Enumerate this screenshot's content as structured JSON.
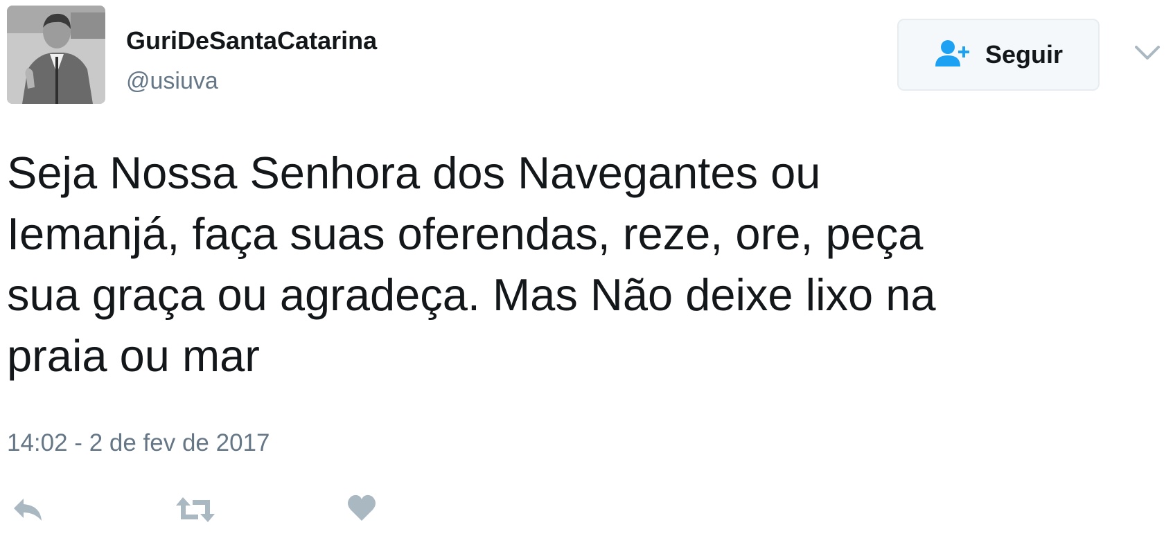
{
  "user": {
    "name": "GuriDeSantaCatarina",
    "handle": "@usiuva"
  },
  "follow_button": {
    "label": "Seguir",
    "icon": "add-user-icon"
  },
  "menu": {
    "icon": "chevron-down-icon"
  },
  "tweet": {
    "lines": [
      "Seja Nossa Senhora dos Navegantes ou",
      "Iemanjá, faça suas oferendas, reze, ore, peça",
      "sua graça ou agradeça. Mas Não deixe lixo na",
      "praia ou mar"
    ],
    "timestamp": "14:02 - 2 de fev de 2017"
  },
  "actions": [
    {
      "name": "reply",
      "icon": "reply-icon"
    },
    {
      "name": "retweet",
      "icon": "retweet-icon"
    },
    {
      "name": "like",
      "icon": "heart-icon"
    }
  ],
  "colors": {
    "text": "#14171a",
    "muted": "#657786",
    "accent": "#1da1f2",
    "action_icon": "#aab8c2",
    "button_bg": "#f5f8fa",
    "button_border": "#e6ecf0"
  }
}
